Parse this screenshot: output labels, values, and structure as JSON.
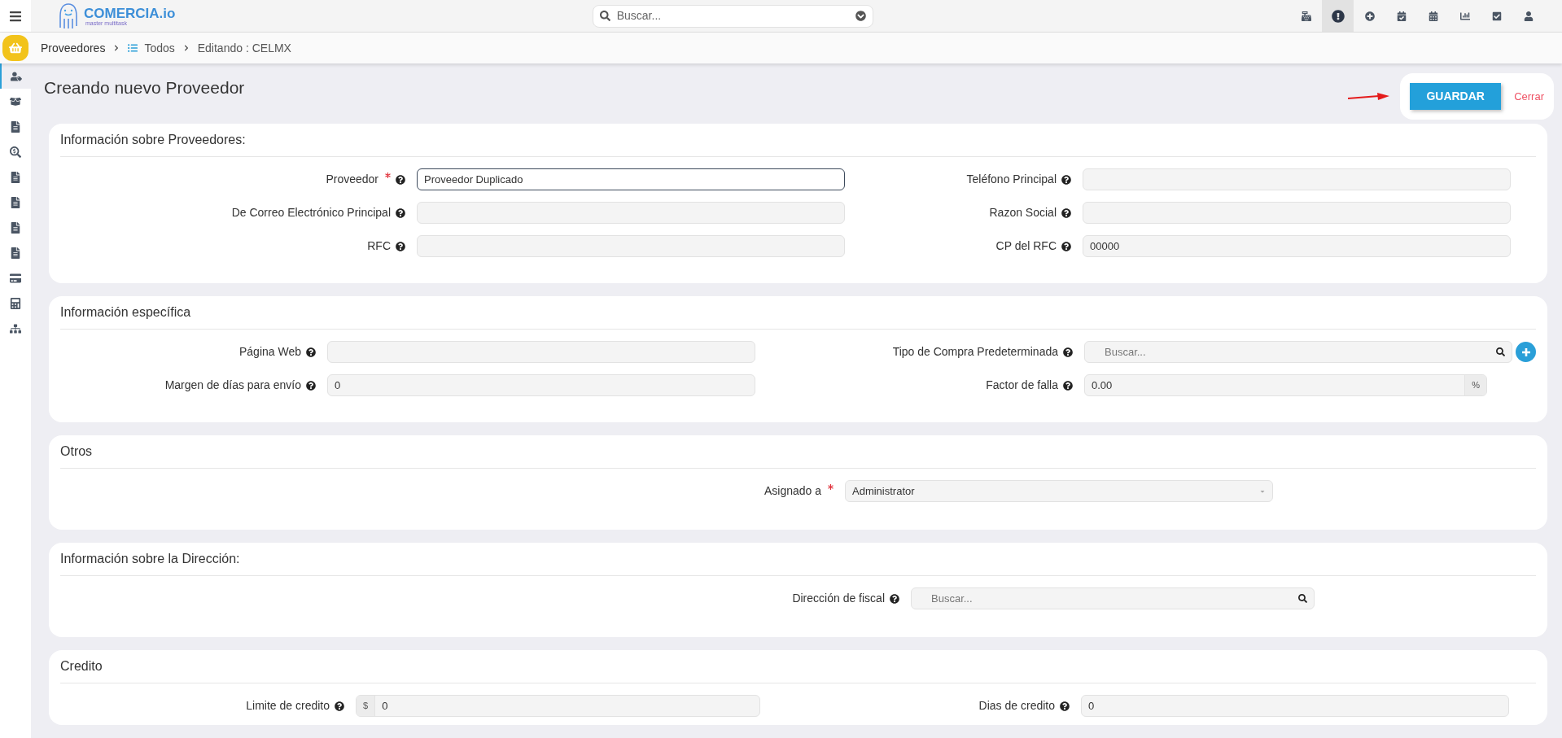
{
  "top_bar": {
    "logo": {
      "name": "COMERCIA.io",
      "tagline": "master multitask"
    },
    "search": {
      "placeholder": "Buscar..."
    },
    "icons": [
      {
        "kind": "register",
        "selected": false
      },
      {
        "kind": "alert",
        "selected": true
      },
      {
        "kind": "add",
        "selected": false
      },
      {
        "kind": "calendar-check",
        "selected": false
      },
      {
        "kind": "calendar",
        "selected": false
      },
      {
        "kind": "chart",
        "selected": false
      },
      {
        "kind": "check",
        "selected": false
      },
      {
        "kind": "user",
        "selected": false
      }
    ]
  },
  "breadcrumb": [
    {
      "label": "Proveedores",
      "kind": "link"
    },
    {
      "label": "Todos",
      "kind": "list"
    },
    {
      "label": "Editando : CELMX",
      "kind": "current"
    }
  ],
  "sidebar": {
    "items": [
      {
        "kind": "suppliers",
        "selected": true
      },
      {
        "kind": "box",
        "selected": false
      },
      {
        "kind": "doc",
        "selected": false
      },
      {
        "kind": "money-search",
        "selected": false
      },
      {
        "kind": "doc",
        "selected": false
      },
      {
        "kind": "doc",
        "selected": false
      },
      {
        "kind": "doc",
        "selected": false
      },
      {
        "kind": "doc",
        "selected": false
      },
      {
        "kind": "card",
        "selected": false
      },
      {
        "kind": "calculator",
        "selected": false
      },
      {
        "kind": "sitemap",
        "selected": false
      }
    ]
  },
  "page": {
    "title": "Creando nuevo Proveedor",
    "save_button": "GUARDAR",
    "close_link": "Cerrar"
  },
  "sections": [
    {
      "title": "Información sobre Proveedores:",
      "left": [
        {
          "label": "Proveedor",
          "required": true,
          "help": true,
          "kind": "text",
          "value": "Proveedor Duplicado",
          "focused": true
        },
        {
          "label": "De Correo Electrónico Principal",
          "required": false,
          "help": true,
          "kind": "text",
          "focused": false
        },
        {
          "label": "RFC",
          "required": false,
          "help": true,
          "kind": "text",
          "focused": false
        }
      ],
      "right": [
        {
          "label": "Teléfono Principal",
          "required": false,
          "help": true,
          "kind": "text",
          "focused": false
        },
        {
          "label": "Razon Social",
          "required": false,
          "help": true,
          "kind": "text",
          "focused": false
        },
        {
          "label": "CP del RFC",
          "required": false,
          "help": true,
          "kind": "text",
          "value": "00000",
          "focused": false
        }
      ]
    },
    {
      "title": "Información específica",
      "left": [
        {
          "label": "Página Web",
          "required": false,
          "help": true,
          "kind": "text",
          "focused": false
        },
        {
          "label": "Margen de días para envío",
          "required": false,
          "help": true,
          "kind": "text",
          "value": "0",
          "focused": false
        }
      ],
      "right": [
        {
          "label": "Tipo de Compra Predeterminada",
          "required": false,
          "help": true,
          "kind": "search",
          "placeholder": "Buscar...",
          "add_button": true,
          "focused": false
        },
        {
          "label": "Factor de falla",
          "required": false,
          "help": true,
          "kind": "percent",
          "value": "0.00",
          "addon": "%",
          "focused": false
        }
      ]
    },
    {
      "title": "Otros",
      "left": [
        {
          "label": "Asignado a",
          "required": true,
          "help": false,
          "kind": "select",
          "value": "Administrator",
          "focused": false
        }
      ]
    },
    {
      "title": "Información sobre la Dirección:",
      "left": [
        {
          "label": "Dirección de fiscal",
          "required": false,
          "help": true,
          "kind": "search",
          "placeholder": "Buscar...",
          "focused": false
        }
      ]
    },
    {
      "title": "Credito",
      "left": [
        {
          "label": "Limite de credito",
          "required": false,
          "help": true,
          "kind": "currency",
          "addon": "$",
          "value": "0",
          "focused": false
        }
      ],
      "right": [
        {
          "label": "Dias de credito",
          "required": false,
          "help": true,
          "kind": "text",
          "value": "0",
          "focused": false
        }
      ]
    }
  ]
}
